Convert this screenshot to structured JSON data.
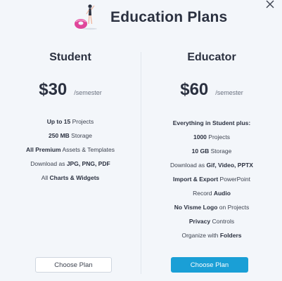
{
  "header": {
    "title": "Education Plans"
  },
  "icons": {
    "close": "close-icon",
    "illustration": "education-illustration"
  },
  "colors": {
    "accent": "#1a9fd6",
    "background": "#f3f6fa",
    "text": "#2b3140"
  },
  "student": {
    "name": "Student",
    "price": "$30",
    "period": "/semester",
    "features": [
      {
        "bold": "Up to 15",
        "rest": " Projects"
      },
      {
        "bold": "250 MB",
        "rest": " Storage"
      },
      {
        "bold": "All Premium",
        "rest": " Assets & Templates"
      },
      {
        "pre": "Download as ",
        "bold": "JPG, PNG, PDF"
      },
      {
        "pre": "All ",
        "bold": "Charts & Widgets"
      }
    ],
    "button": "Choose Plan"
  },
  "educator": {
    "name": "Educator",
    "price": "$60",
    "period": "/semester",
    "features": [
      {
        "bold": "Everything in Student plus:"
      },
      {
        "bold": "1000",
        "rest": " Projects"
      },
      {
        "bold": "10 GB",
        "rest": " Storage"
      },
      {
        "pre": "Download as ",
        "bold": "Gif, Video, PPTX"
      },
      {
        "bold": "Import & Export",
        "rest": " PowerPoint"
      },
      {
        "pre": "Record ",
        "bold": "Audio"
      },
      {
        "bold": "No Visme Logo",
        "rest": " on Projects"
      },
      {
        "bold": "Privacy",
        "rest": " Controls"
      },
      {
        "pre": "Organize with ",
        "bold": "Folders"
      }
    ],
    "button": "Choose Plan"
  }
}
